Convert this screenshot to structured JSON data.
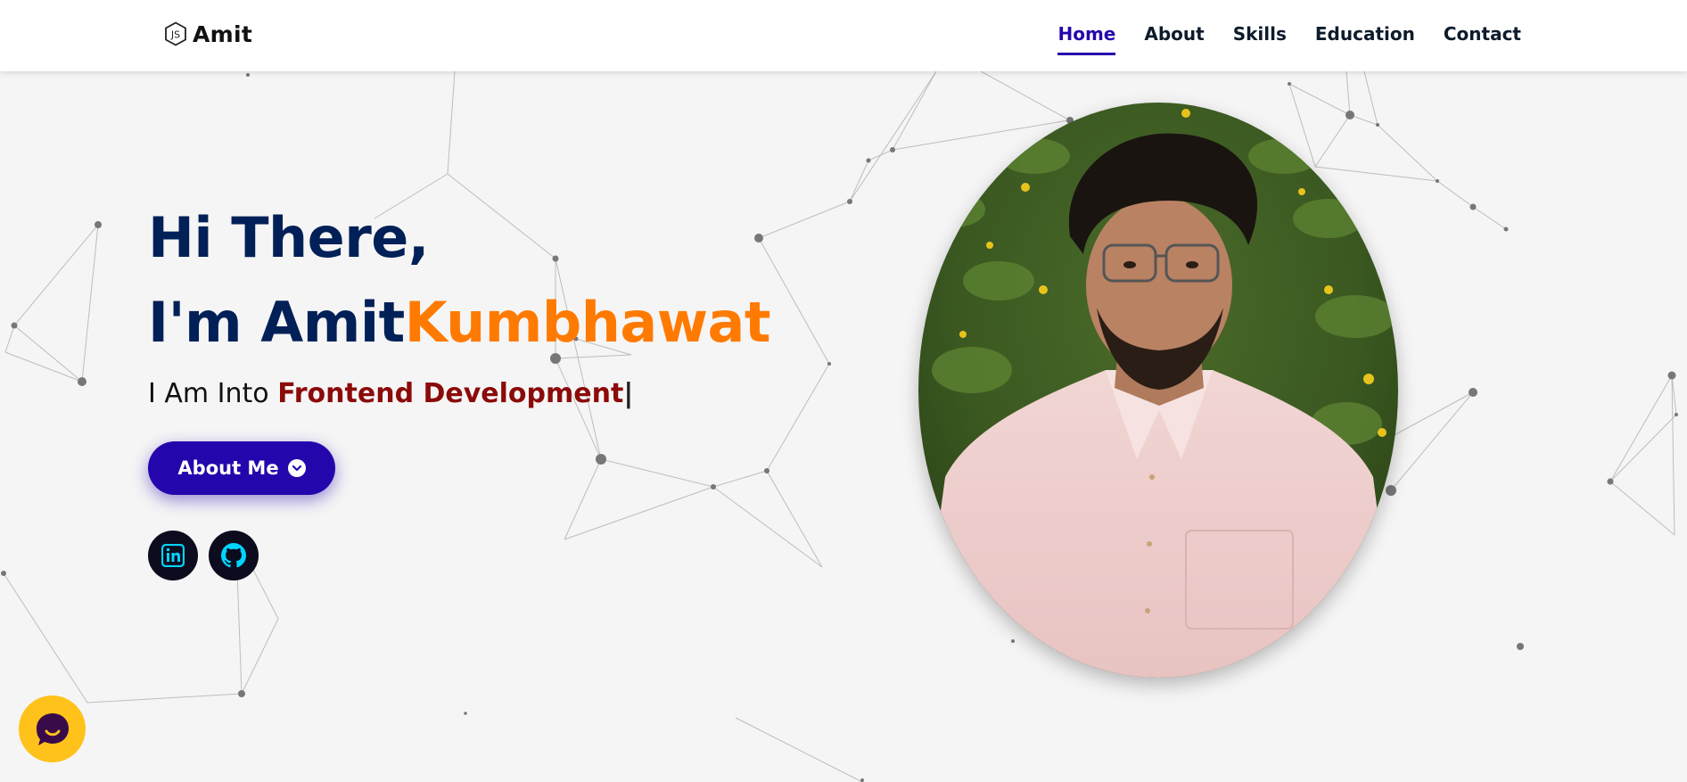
{
  "brand": {
    "name": "Amit",
    "icon": "nodejs-hexagon-icon"
  },
  "nav": {
    "items": [
      {
        "label": "Home",
        "active": true
      },
      {
        "label": "About",
        "active": false
      },
      {
        "label": "Skills",
        "active": false
      },
      {
        "label": "Education",
        "active": false
      },
      {
        "label": "Contact",
        "active": false
      }
    ]
  },
  "hero": {
    "greeting": "Hi There,",
    "name_prefix": "I'm Amit",
    "name_highlight": "Kumbhawat",
    "subtitle_prefix": "I Am Into ",
    "subtitle_typed": "Frontend Development",
    "cursor": "|",
    "button_label": "About Me",
    "button_icon": "chevron-down-circle-icon"
  },
  "social": [
    {
      "name": "linkedin",
      "icon": "linkedin-icon"
    },
    {
      "name": "github",
      "icon": "github-icon"
    }
  ],
  "chat": {
    "icon": "chat-widget-icon"
  },
  "colors": {
    "primary": "#2506ad",
    "heading": "#002057",
    "accent": "#ff7a00",
    "typed": "#8b0a0a",
    "social_icon": "#00d4ff"
  }
}
